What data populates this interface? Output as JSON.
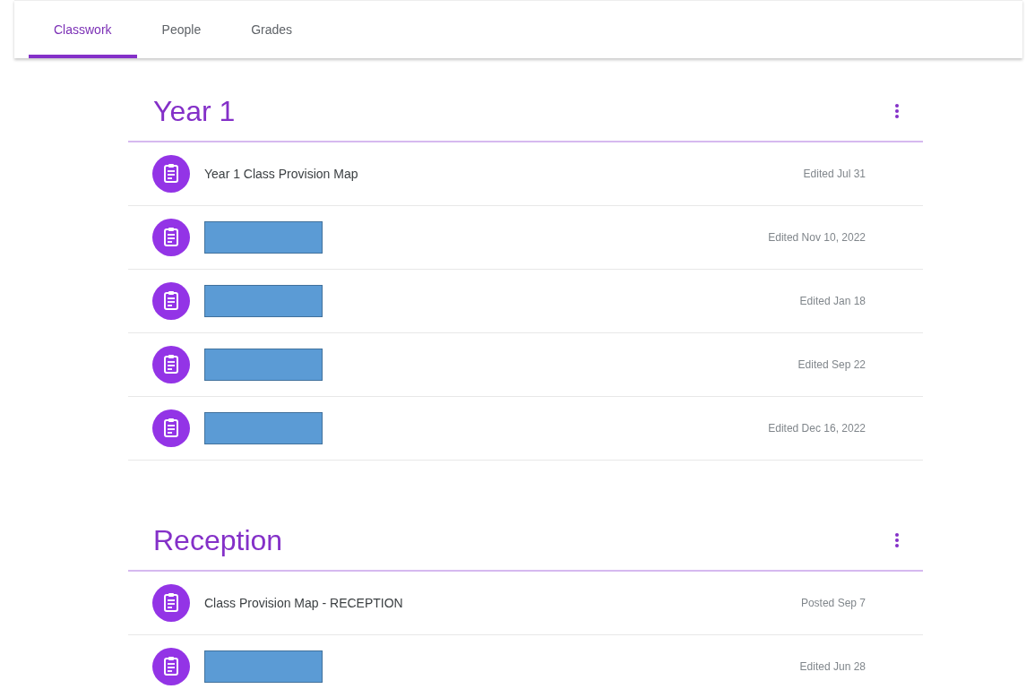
{
  "tabs": [
    {
      "label": "Classwork",
      "selected": true
    },
    {
      "label": "People",
      "selected": false
    },
    {
      "label": "Grades",
      "selected": false
    }
  ],
  "topics": [
    {
      "title": "Year 1",
      "items": [
        {
          "kind": "material",
          "title": "Year 1 Class Provision Map",
          "date": "Edited Jul 31"
        },
        {
          "kind": "redacted",
          "date": "Edited Nov 10, 2022"
        },
        {
          "kind": "redacted",
          "date": "Edited Jan 18"
        },
        {
          "kind": "redacted",
          "date": "Edited Sep 22"
        },
        {
          "kind": "redacted",
          "date": "Edited Dec 16, 2022"
        }
      ]
    },
    {
      "title": "Reception",
      "items": [
        {
          "kind": "material",
          "title": "Class Provision Map - RECEPTION",
          "date": "Posted Sep 7"
        },
        {
          "kind": "redacted",
          "date": "Edited Jun 28"
        }
      ]
    }
  ]
}
